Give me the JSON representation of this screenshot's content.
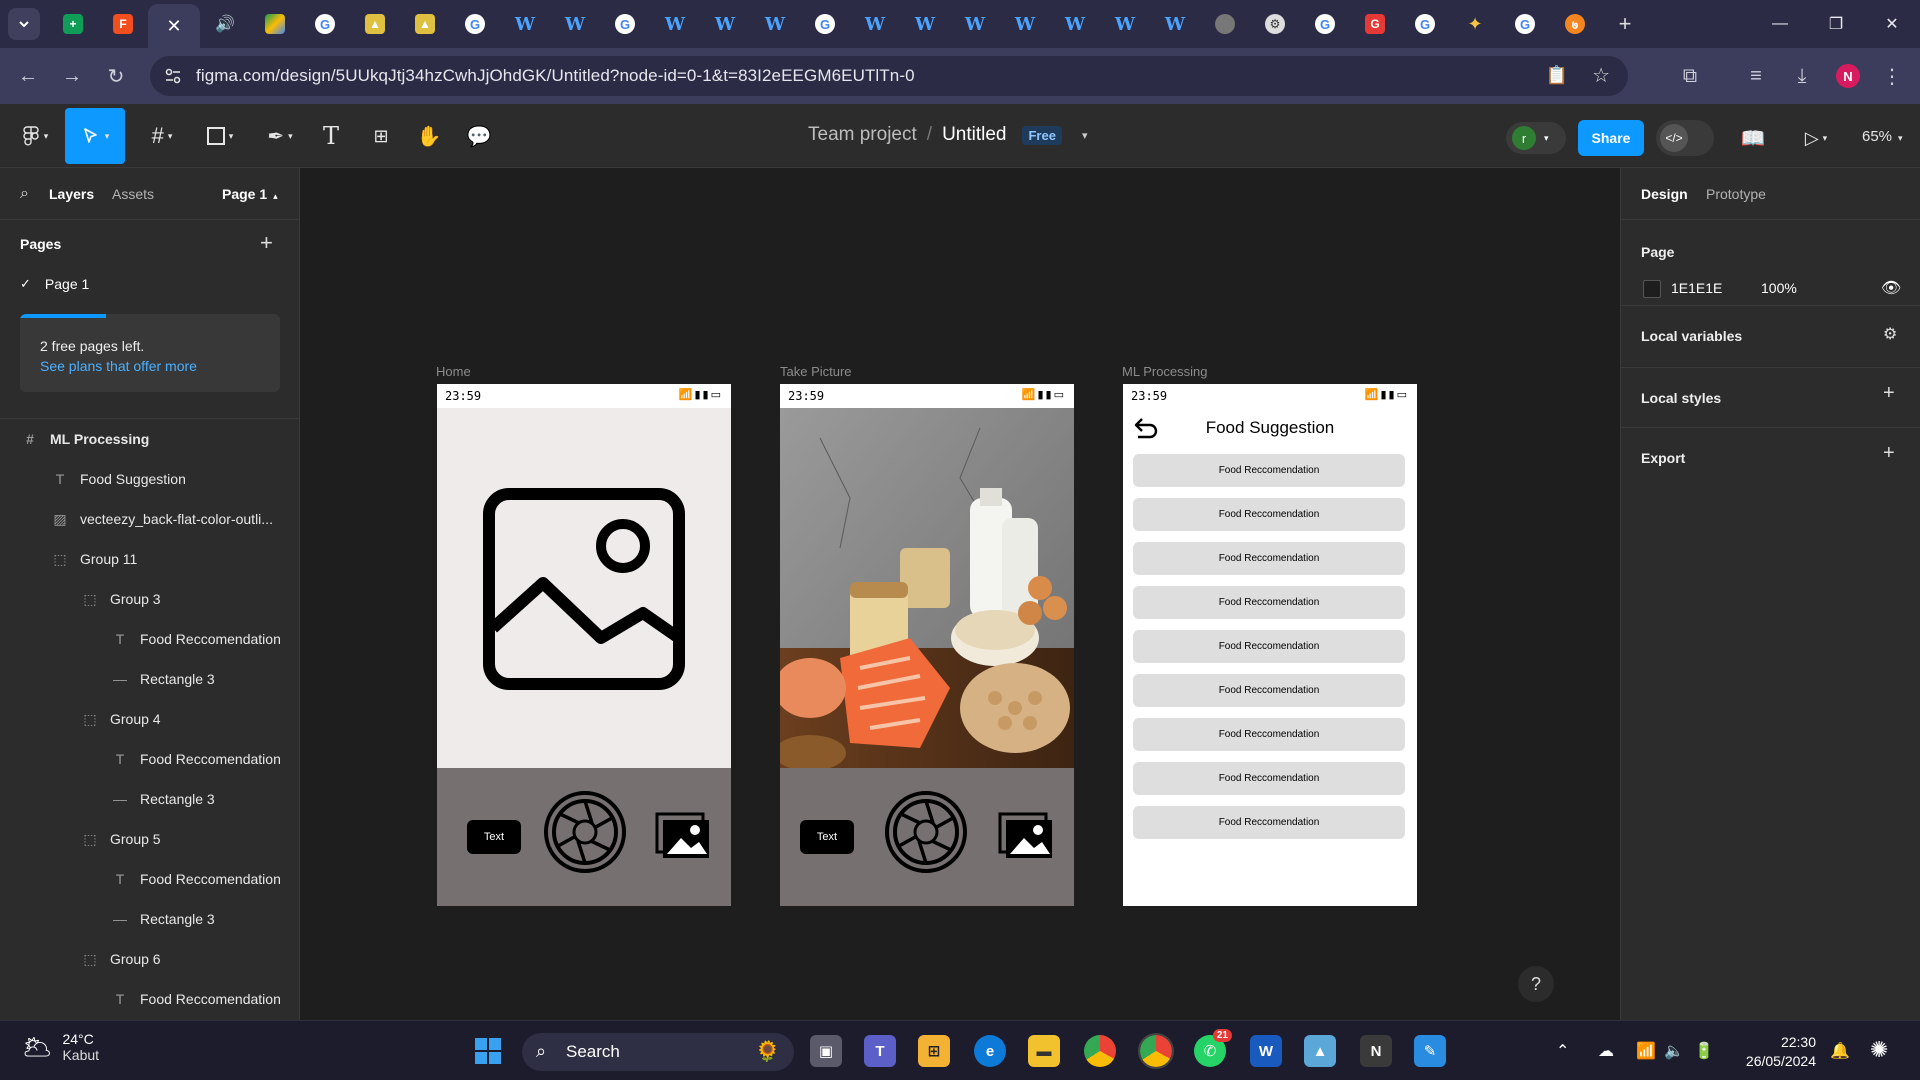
{
  "browser": {
    "url": "figma.com/design/5UUkqJtj34hzCwhJjOhdGK/Untitled?node-id=0-1&t=83I2eEEGM6EUTlTn-0",
    "profile_initial": "N",
    "colors": {
      "tabbar": "#2b2b45",
      "toolbar": "#3c3c5c"
    }
  },
  "figma": {
    "team": "Team project",
    "separator": "/",
    "file_name": "Untitled",
    "plan_badge": "Free",
    "avatar_initial": "r",
    "share_label": "Share",
    "zoom": "65%",
    "accent": "#0d99ff"
  },
  "left_panel": {
    "tab_layers": "Layers",
    "tab_assets": "Assets",
    "page_selector": "Page 1",
    "pages_title": "Pages",
    "current_page": "Page 1",
    "free_pages_text": "2 free pages left.",
    "free_pages_link": "See plans that offer more",
    "free_pages_used_fraction": 0.33,
    "layers": [
      {
        "name": "ML Processing",
        "type": "frame",
        "depth": 0
      },
      {
        "name": "Food Suggestion",
        "type": "text",
        "depth": 1
      },
      {
        "name": "vecteezy_back-flat-color-outli...",
        "type": "image",
        "depth": 1
      },
      {
        "name": "Group 11",
        "type": "group",
        "depth": 1
      },
      {
        "name": "Group 3",
        "type": "group",
        "depth": 2
      },
      {
        "name": "Food Reccomendation",
        "type": "text",
        "depth": 3
      },
      {
        "name": "Rectangle 3",
        "type": "rect",
        "depth": 3
      },
      {
        "name": "Group 4",
        "type": "group",
        "depth": 2
      },
      {
        "name": "Food Reccomendation",
        "type": "text",
        "depth": 3
      },
      {
        "name": "Rectangle 3",
        "type": "rect",
        "depth": 3
      },
      {
        "name": "Group 5",
        "type": "group",
        "depth": 2
      },
      {
        "name": "Food Reccomendation",
        "type": "text",
        "depth": 3
      },
      {
        "name": "Rectangle 3",
        "type": "rect",
        "depth": 3
      },
      {
        "name": "Group 6",
        "type": "group",
        "depth": 2
      },
      {
        "name": "Food Reccomendation",
        "type": "text",
        "depth": 3
      }
    ]
  },
  "right_panel": {
    "tab_design": "Design",
    "tab_prototype": "Prototype",
    "page_title": "Page",
    "page_color": "1E1E1E",
    "page_opacity": "100%",
    "local_variables": "Local variables",
    "local_styles": "Local styles",
    "export": "Export"
  },
  "canvas": {
    "frames": [
      {
        "label": "Home",
        "time": "23:59",
        "text_button": "Text"
      },
      {
        "label": "Take Picture",
        "time": "23:59",
        "text_button": "Text"
      },
      {
        "label": "ML Processing",
        "time": "23:59",
        "title": "Food Suggestion",
        "items": [
          "Food Reccomendation",
          "Food Reccomendation",
          "Food Reccomendation",
          "Food Reccomendation",
          "Food Reccomendation",
          "Food Reccomendation",
          "Food Reccomendation",
          "Food Reccomendation",
          "Food Reccomendation"
        ]
      }
    ],
    "help": "?"
  },
  "taskbar": {
    "temperature": "24°C",
    "condition": "Kabut",
    "search_label": "Search",
    "time": "22:30",
    "date": "26/05/2024",
    "whatsapp_badge": "21"
  }
}
